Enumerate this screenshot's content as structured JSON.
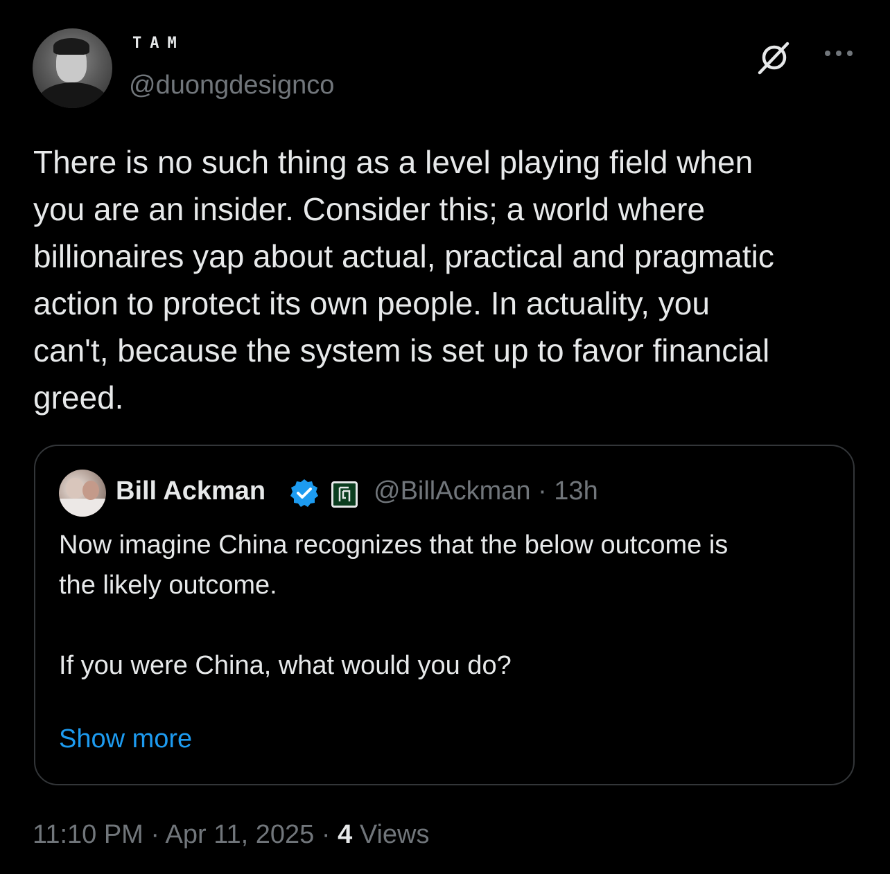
{
  "author": {
    "display_name": "TAM",
    "handle": "@duongdesignco"
  },
  "header_icons": [
    "grok-icon",
    "more-icon"
  ],
  "post": {
    "text": "There is no such thing as a level playing field when\nyou are an insider. Consider this; a world where\nbillionaires yap about actual, practical and pragmatic\naction to protect its own people. In actuality, you\ncan't, because the system is set up to favor financial\ngreed."
  },
  "quote": {
    "name": "Bill Ackman",
    "handle": "@BillAckman",
    "separator": "·",
    "time": "13h",
    "text": "Now imagine China recognizes that the below outcome is\nthe likely outcome.\n\nIf you were China, what would you do?",
    "show_more_label": "Show more",
    "accent_color": "#1d9bf0",
    "badges": [
      "verified-icon",
      "affiliate-icon"
    ]
  },
  "footer": {
    "time": "11:10 PM",
    "separator_1": "·",
    "date": "Apr 11, 2025",
    "separator_2": "·",
    "views_count": "4",
    "views_label": "Views"
  }
}
